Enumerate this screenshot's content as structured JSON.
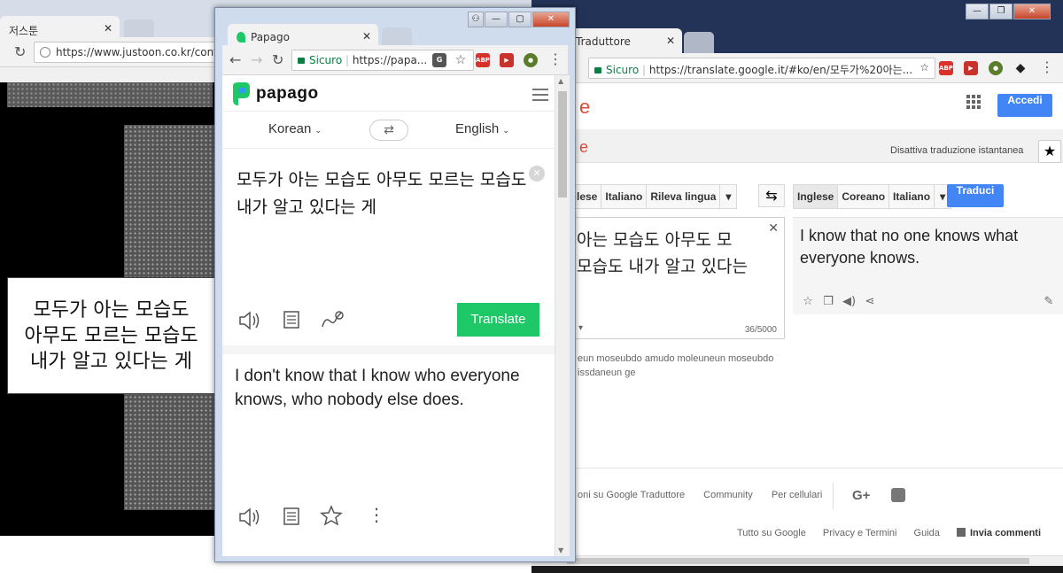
{
  "left_window": {
    "tab_title": "저스툰",
    "url": "https://www.justoon.co.kr/conten",
    "bubble_lines": [
      "모두가 아는 모습도",
      "아무도 모르는 모습도",
      "내가 알고 있다는 게"
    ]
  },
  "papago_window": {
    "tab_title": "Papago",
    "url_secure": "Sicuro",
    "url": "https://papa...",
    "logo_text": "papago",
    "source_lang": "Korean",
    "target_lang": "English",
    "source_text": "모두가 아는 모습도 아무도 모르는 모습도 내가 알고 있다는 게",
    "translate_label": "Translate",
    "result_text": "I don't know that I know who everyone knows, who nobody else does.",
    "icons": [
      "speaker-icon",
      "copy-icon",
      "handwriting-icon",
      "star-icon",
      "more-icon",
      "menu-icon",
      "swap-icon",
      "clear-icon"
    ]
  },
  "gt_window": {
    "tab_title": "Traduttore",
    "url_secure": "Sicuro",
    "url": "https://translate.google.it/#ko/en/모두가%20아는...",
    "accedi_label": "Accedi",
    "instant_label": "Disattiva traduzione istantanea",
    "source_tabs": [
      "lese",
      "Italiano",
      "Rileva lingua"
    ],
    "target_tabs": [
      "Inglese",
      "Coreano",
      "Italiano"
    ],
    "translate_label": "Traduci",
    "source_text_line1": "아는 모습도 아무도 모",
    "source_text_line2": "모습도 내가 알고 있다는",
    "char_count": "36/5000",
    "romanization_line1": "eun moseubdo amudo moleuneun moseubdo",
    "romanization_line2": "issdaneun ge",
    "result_text": "I know that no one knows what everyone knows.",
    "footer_row1": [
      "oni su Google Traduttore",
      "Community",
      "Per cellulari"
    ],
    "footer_row2": [
      "Tutto su Google",
      "Privacy e Termini",
      "Guida",
      "Invia commenti"
    ],
    "colors": {
      "accent_blue": "#4285f4",
      "brand_red": "#dd4b39"
    }
  }
}
